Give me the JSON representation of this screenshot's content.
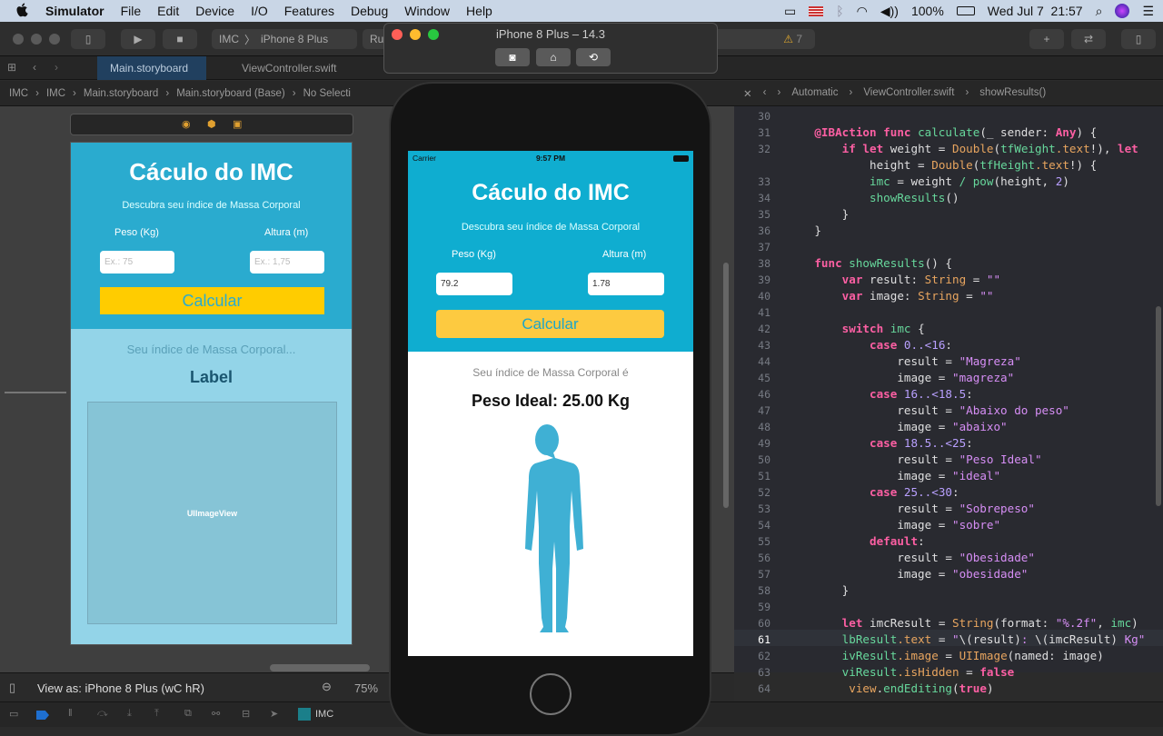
{
  "menubar": {
    "app": "Simulator",
    "items": [
      "File",
      "Edit",
      "Device",
      "I/O",
      "Features",
      "Debug",
      "Window",
      "Help"
    ],
    "battery": "100%",
    "datetime": "Wed Jul 7  21:57"
  },
  "toolbar": {
    "scheme": "IMC",
    "device": "iPhone 8 Plus",
    "status": "Ru",
    "warnings": "7"
  },
  "tabs": [
    "Main.storyboard",
    "ViewController.swift"
  ],
  "jumpbar_left": [
    "IMC",
    "IMC",
    "Main.storyboard",
    "Main.storyboard (Base)",
    "No Selecti"
  ],
  "jumpbar_right": [
    "Automatic",
    "ViewController.swift",
    "showResults()"
  ],
  "storyboard": {
    "title": "Cáculo do IMC",
    "subtitle": "Descubra seu índice de Massa Corporal",
    "weight_label": "Peso (Kg)",
    "height_label": "Altura (m)",
    "weight_placeholder": "Ex.: 75",
    "height_placeholder": "Ex.: 1,75",
    "button": "Calcular",
    "result_caption": "Seu índice de Massa Corporal...",
    "result_label": "Label",
    "image_placeholder": "UIImageView"
  },
  "bottom": {
    "view_as": "View as: iPhone 8 Plus (wC hR)",
    "zoom": "75%",
    "scheme": "IMC"
  },
  "simulator": {
    "title": "iPhone 8 Plus – 14.3",
    "carrier": "Carrier",
    "time": "9:57 PM",
    "app_title": "Cáculo do IMC",
    "subtitle": "Descubra seu índice de Massa Corporal",
    "weight_label": "Peso (Kg)",
    "height_label": "Altura (m)",
    "weight_value": "79.2",
    "height_value": "1.78",
    "button": "Calcular",
    "result_caption": "Seu índice de Massa Corporal é",
    "result": "Peso Ideal: 25.00 Kg"
  },
  "code": [
    {
      "n": "30",
      "t": []
    },
    {
      "n": "31",
      "t": [
        [
          "kw",
          "    @IBAction func "
        ],
        [
          "fn",
          "calculate"
        ],
        [
          "pl",
          "(_ sender: "
        ],
        [
          "kw",
          "Any"
        ],
        [
          "pl",
          ") {"
        ]
      ]
    },
    {
      "n": "32",
      "t": [
        [
          "kw",
          "        if let "
        ],
        [
          "pl",
          "weight = "
        ],
        [
          "ty",
          "Double"
        ],
        [
          "pl",
          "("
        ],
        [
          "fn",
          "tfWeight"
        ],
        [
          "pr",
          ".text"
        ],
        [
          "pl",
          "!), "
        ],
        [
          "kw",
          "let"
        ]
      ]
    },
    {
      "n": "",
      "t": [
        [
          "pl",
          "            height = "
        ],
        [
          "ty",
          "Double"
        ],
        [
          "pl",
          "("
        ],
        [
          "fn",
          "tfHeight"
        ],
        [
          "pr",
          ".text"
        ],
        [
          "pl",
          "!) {"
        ]
      ]
    },
    {
      "n": "33",
      "t": [
        [
          "fn",
          "            imc"
        ],
        [
          "pl",
          " = weight "
        ],
        [
          "fn",
          "/ pow"
        ],
        [
          "pl",
          "(height, "
        ],
        [
          "nu",
          "2"
        ],
        [
          "pl",
          ")"
        ]
      ]
    },
    {
      "n": "34",
      "t": [
        [
          "fn",
          "            showResults"
        ],
        [
          "pl",
          "()"
        ]
      ]
    },
    {
      "n": "35",
      "t": [
        [
          "pl",
          "        }"
        ]
      ]
    },
    {
      "n": "36",
      "t": [
        [
          "pl",
          "    }"
        ]
      ]
    },
    {
      "n": "37",
      "t": []
    },
    {
      "n": "38",
      "t": [
        [
          "kw",
          "    func "
        ],
        [
          "fn",
          "showResults"
        ],
        [
          "pl",
          "() {"
        ]
      ]
    },
    {
      "n": "39",
      "t": [
        [
          "kw",
          "        var "
        ],
        [
          "pl",
          "result: "
        ],
        [
          "ty",
          "String"
        ],
        [
          "pl",
          " = "
        ],
        [
          "st",
          "\"\""
        ]
      ]
    },
    {
      "n": "40",
      "t": [
        [
          "kw",
          "        var "
        ],
        [
          "pl",
          "image: "
        ],
        [
          "ty",
          "String"
        ],
        [
          "pl",
          " = "
        ],
        [
          "st",
          "\"\""
        ]
      ]
    },
    {
      "n": "41",
      "t": []
    },
    {
      "n": "42",
      "t": [
        [
          "kw",
          "        switch "
        ],
        [
          "fn",
          "imc"
        ],
        [
          "pl",
          " {"
        ]
      ]
    },
    {
      "n": "43",
      "t": [
        [
          "kw",
          "            case "
        ],
        [
          "nu",
          "0..<16"
        ],
        [
          "pl",
          ":"
        ]
      ]
    },
    {
      "n": "44",
      "t": [
        [
          "pl",
          "                result = "
        ],
        [
          "st",
          "\"Magreza\""
        ]
      ]
    },
    {
      "n": "45",
      "t": [
        [
          "pl",
          "                image = "
        ],
        [
          "st",
          "\"magreza\""
        ]
      ]
    },
    {
      "n": "46",
      "t": [
        [
          "kw",
          "            case "
        ],
        [
          "nu",
          "16..<18.5"
        ],
        [
          "pl",
          ":"
        ]
      ]
    },
    {
      "n": "47",
      "t": [
        [
          "pl",
          "                result = "
        ],
        [
          "st",
          "\"Abaixo do peso\""
        ]
      ]
    },
    {
      "n": "48",
      "t": [
        [
          "pl",
          "                image = "
        ],
        [
          "st",
          "\"abaixo\""
        ]
      ]
    },
    {
      "n": "49",
      "t": [
        [
          "kw",
          "            case "
        ],
        [
          "nu",
          "18.5..<25"
        ],
        [
          "pl",
          ":"
        ]
      ]
    },
    {
      "n": "50",
      "t": [
        [
          "pl",
          "                result = "
        ],
        [
          "st",
          "\"Peso Ideal\""
        ]
      ]
    },
    {
      "n": "51",
      "t": [
        [
          "pl",
          "                image = "
        ],
        [
          "st",
          "\"ideal\""
        ]
      ]
    },
    {
      "n": "52",
      "t": [
        [
          "kw",
          "            case "
        ],
        [
          "nu",
          "25..<30"
        ],
        [
          "pl",
          ":"
        ]
      ]
    },
    {
      "n": "53",
      "t": [
        [
          "pl",
          "                result = "
        ],
        [
          "st",
          "\"Sobrepeso\""
        ]
      ]
    },
    {
      "n": "54",
      "t": [
        [
          "pl",
          "                image = "
        ],
        [
          "st",
          "\"sobre\""
        ]
      ]
    },
    {
      "n": "55",
      "t": [
        [
          "kw",
          "            default"
        ],
        [
          "pl",
          ":"
        ]
      ]
    },
    {
      "n": "56",
      "t": [
        [
          "pl",
          "                result = "
        ],
        [
          "st",
          "\"Obesidade\""
        ]
      ]
    },
    {
      "n": "57",
      "t": [
        [
          "pl",
          "                image = "
        ],
        [
          "st",
          "\"obesidade\""
        ]
      ]
    },
    {
      "n": "58",
      "t": [
        [
          "pl",
          "        }"
        ]
      ]
    },
    {
      "n": "59",
      "t": []
    },
    {
      "n": "60",
      "t": [
        [
          "kw",
          "        let "
        ],
        [
          "pl",
          "imcResult = "
        ],
        [
          "ty",
          "String"
        ],
        [
          "pl",
          "(format: "
        ],
        [
          "st",
          "\"%.2f\""
        ],
        [
          "pl",
          ", "
        ],
        [
          "fn",
          "imc"
        ],
        [
          "pl",
          ")"
        ]
      ]
    },
    {
      "n": "61",
      "t": [
        [
          "fn",
          "        lbResult"
        ],
        [
          "pr",
          ".text"
        ],
        [
          "pl",
          " = "
        ],
        [
          "st",
          "\""
        ],
        [
          "pl",
          "\\(result)"
        ],
        [
          "st",
          ": "
        ],
        [
          "pl",
          "\\(imcResult)"
        ],
        [
          "st",
          " Kg\""
        ]
      ]
    },
    {
      "n": "62",
      "t": [
        [
          "fn",
          "        ivResult"
        ],
        [
          "pr",
          ".image"
        ],
        [
          "pl",
          " = "
        ],
        [
          "ty",
          "UIImage"
        ],
        [
          "pl",
          "(named: image)"
        ]
      ]
    },
    {
      "n": "63",
      "t": [
        [
          "fn",
          "        viResult"
        ],
        [
          "pr",
          ".isHidden"
        ],
        [
          "pl",
          " = "
        ],
        [
          "kw",
          "false"
        ]
      ]
    },
    {
      "n": "64",
      "t": [
        [
          "pr",
          "         view"
        ],
        [
          "pl",
          "."
        ],
        [
          "fn",
          "endEditing"
        ],
        [
          "pl",
          "("
        ],
        [
          "kw",
          "true"
        ],
        [
          "pl",
          ")"
        ]
      ]
    }
  ]
}
